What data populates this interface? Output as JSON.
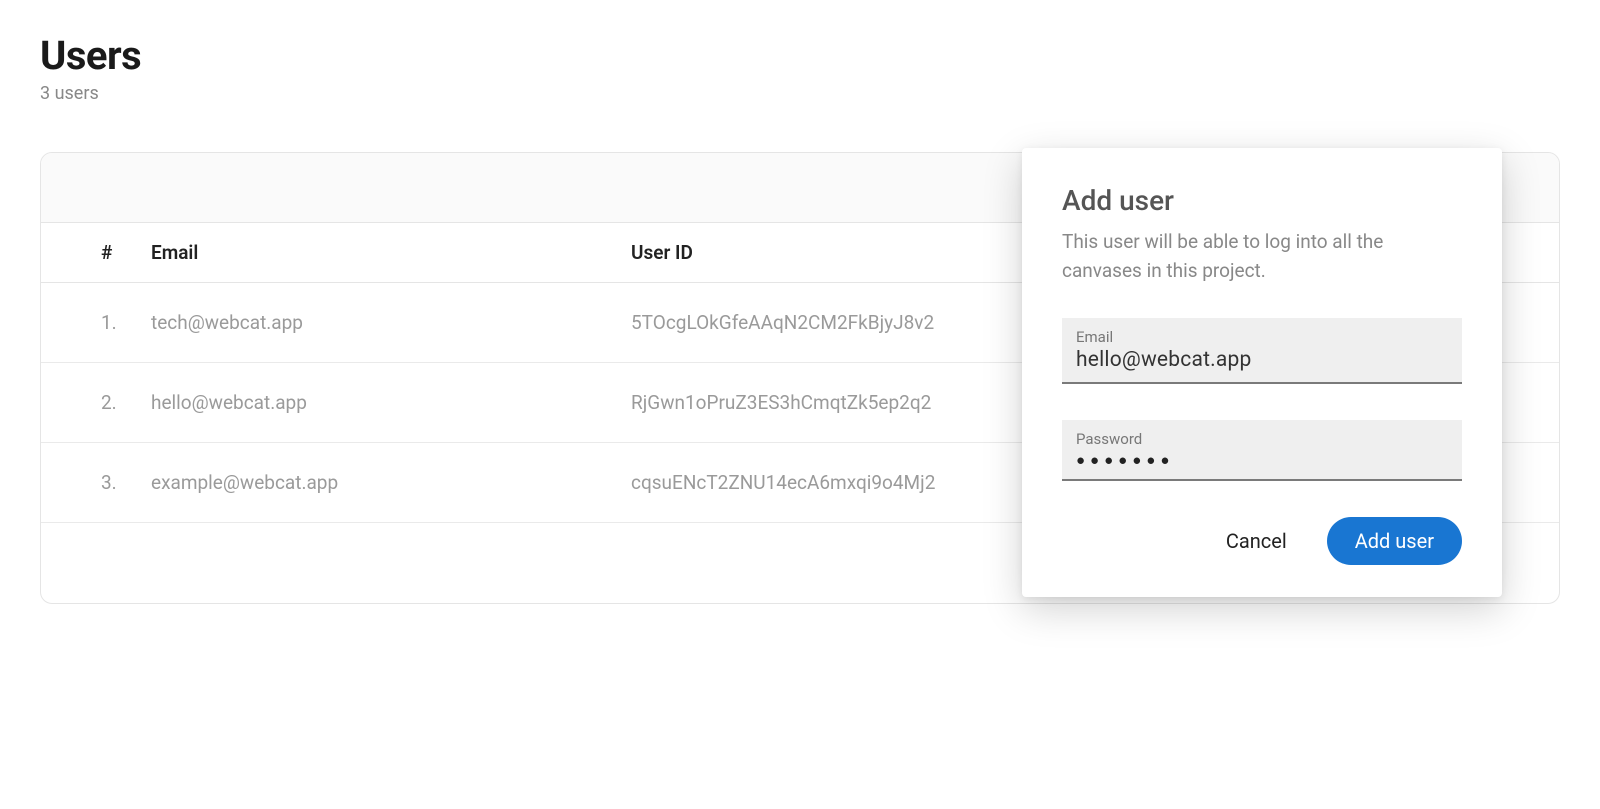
{
  "header": {
    "title": "Users",
    "subtitle": "3 users"
  },
  "table": {
    "columns": {
      "index": "#",
      "email": "Email",
      "user_id": "User ID"
    },
    "rows": [
      {
        "index": "1.",
        "email": "tech@webcat.app",
        "user_id": "5TOcgLOkGfeAAqN2CM2FkBjyJ8v2"
      },
      {
        "index": "2.",
        "email": "hello@webcat.app",
        "user_id": "RjGwn1oPruZ3ES3hCmqtZk5ep2q2"
      },
      {
        "index": "3.",
        "email": "example@webcat.app",
        "user_id": "cqsuENcT2ZNU14ecA6mxqi9o4Mj2"
      }
    ]
  },
  "dialog": {
    "title": "Add user",
    "description": "This user will be able to log into all the canvases in this project.",
    "email_label": "Email",
    "email_value": "hello@webcat.app",
    "password_label": "Password",
    "password_value": "●●●●●●●",
    "cancel_label": "Cancel",
    "submit_label": "Add user"
  },
  "colors": {
    "primary": "#1976d2"
  }
}
